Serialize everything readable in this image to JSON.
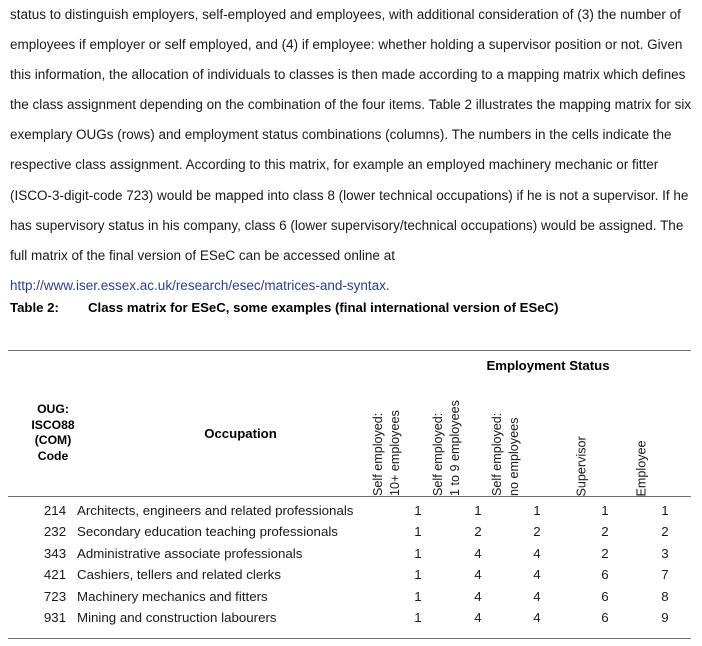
{
  "prose": {
    "paragraph1": "status to distinguish employers, self-employed and employees, with additional consideration of (3) the number of employees if employer or self employed, and (4) if employee: whether holding a supervisor position or not. Given this information, the allocation of individuals to classes is then made according to a mapping matrix which defines the class assignment depending on the combination of the four items. Table 2 illustrates the mapping matrix for six exemplary OUGs (rows) and employment status combinations (columns). The numbers in the cells indicate the respective class assignment. According to this matrix, for example an employed machinery mechanic or fitter (ISCO-3-digit-code 723) would be mapped into class 8 (lower technical occupations) if he is not a supervisor. If he has supervisory status in his company, class 6 (lower supervisory/technical occupations) would be assigned. The full matrix of the final version of ESeC can be accessed online at ",
    "link_text": "http://www.iser.essex.ac.uk/research/esec/matrices-and-syntax",
    "link_trailing": ".",
    "link_color": "#2e3d90"
  },
  "table": {
    "caption_label": "Table 2:",
    "caption_text": "Class matrix for ESeC, some examples (final international version of ESeC)",
    "group_header": "Employment Status",
    "header_oug": [
      "OUG:",
      "ISCO88",
      "(COM)",
      "Code"
    ],
    "header_occupation": "Occupation",
    "vertical_headers": [
      {
        "line1": "Self employed:",
        "line2": "10+ employees"
      },
      {
        "line1": "Self employed:",
        "line2": "1 to 9 employees"
      },
      {
        "line1": "Self employed:",
        "line2": "no employees"
      },
      {
        "line1": "Supervisor",
        "line2": ""
      },
      {
        "line1": "Employee",
        "line2": ""
      }
    ],
    "rows": [
      {
        "code": "214",
        "occupation": "Architects, engineers and related professionals",
        "values": [
          "1",
          "1",
          "1",
          "1",
          "1"
        ]
      },
      {
        "code": "232",
        "occupation": "Secondary education teaching professionals",
        "values": [
          "1",
          "2",
          "2",
          "2",
          "2"
        ]
      },
      {
        "code": "343",
        "occupation": "Administrative associate professionals",
        "values": [
          "1",
          "4",
          "4",
          "2",
          "3"
        ]
      },
      {
        "code": "421",
        "occupation": "Cashiers, tellers and related clerks",
        "values": [
          "1",
          "4",
          "4",
          "6",
          "7"
        ]
      },
      {
        "code": "723",
        "occupation": "Machinery mechanics and fitters",
        "values": [
          "1",
          "4",
          "4",
          "6",
          "8"
        ]
      },
      {
        "code": "931",
        "occupation": "Mining and construction labourers",
        "values": [
          "1",
          "4",
          "4",
          "6",
          "9"
        ]
      }
    ]
  }
}
